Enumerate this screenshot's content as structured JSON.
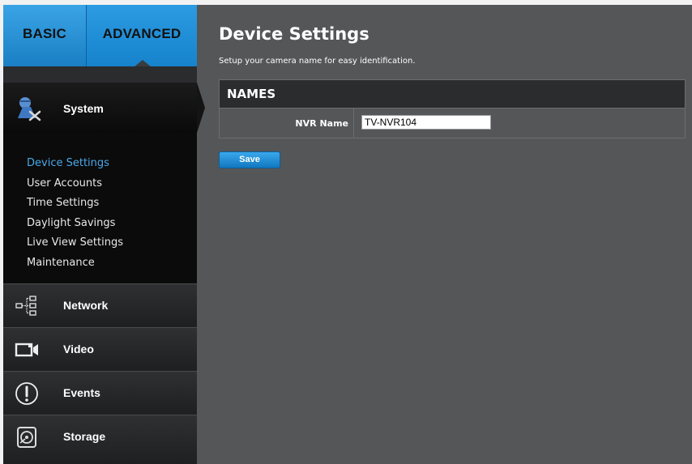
{
  "tabs": {
    "basic": "BASIC",
    "advanced": "ADVANCED"
  },
  "sidebar": {
    "system": {
      "label": "System",
      "icon": "system-tools-icon",
      "items": [
        {
          "label": "Device Settings",
          "active": true
        },
        {
          "label": "User Accounts"
        },
        {
          "label": "Time Settings"
        },
        {
          "label": "Daylight Savings"
        },
        {
          "label": "Live View Settings"
        },
        {
          "label": "Maintenance"
        }
      ]
    },
    "nav": [
      {
        "label": "Network",
        "icon": "network-tree-icon"
      },
      {
        "label": "Video",
        "icon": "video-camera-icon"
      },
      {
        "label": "Events",
        "icon": "alert-icon"
      },
      {
        "label": "Storage",
        "icon": "hard-drive-icon"
      }
    ]
  },
  "main": {
    "title": "Device Settings",
    "subtitle": "Setup your camera name for easy identification.",
    "section": {
      "title": "NAMES",
      "field_label": "NVR Name",
      "field_value": "TV-NVR104"
    },
    "save_label": "Save"
  },
  "colors": {
    "accent": "#1a86d0",
    "active_link": "#4aa8ea",
    "main_bg": "#555658",
    "sidebar_bg": "#0b0b0b"
  }
}
